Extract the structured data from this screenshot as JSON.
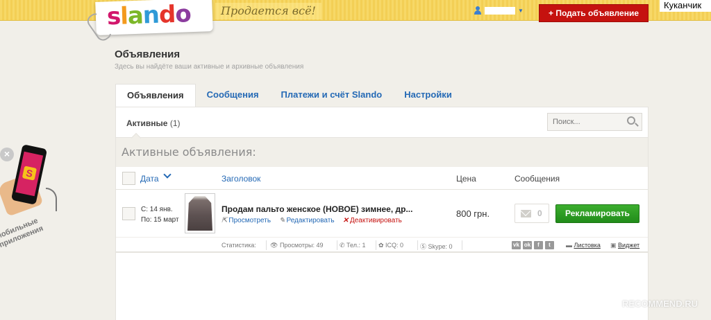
{
  "header": {
    "logo_text": "slando",
    "slogan": "Продается всё!",
    "post_button": "+ Подать объявление",
    "corner_name": "Куканчик"
  },
  "page": {
    "title": "Объявления",
    "subtitle": "Здесь вы найдёте ваши активные и архивные объявления"
  },
  "tabs": [
    {
      "label": "Объявления",
      "active": true
    },
    {
      "label": "Сообщения",
      "active": false
    },
    {
      "label": "Платежи и счёт Slando",
      "active": false
    },
    {
      "label": "Настройки",
      "active": false
    }
  ],
  "subbar": {
    "active_label": "Активные",
    "active_count": "(1)",
    "search_placeholder": "Поиск..."
  },
  "section_title": "Активные объявления:",
  "table": {
    "headers": {
      "date": "Дата",
      "title": "Заголовок",
      "price": "Цена",
      "messages": "Сообщения"
    }
  },
  "ad": {
    "date_from": "С: 14 янв.",
    "date_to": "По: 15 март",
    "title": "Продам пальто женское (НОВОЕ) зимнее, др...",
    "link_view": "Просмотреть",
    "link_edit": "Редактировать",
    "link_deactivate": "Деактивировать",
    "price": "800 грн.",
    "messages_count": "0",
    "promote_button": "Рекламировать"
  },
  "stats": {
    "label": "Статистика:",
    "views": "Просмотры: 49",
    "phone": "Тел.: 1",
    "icq": "ICQ: 0",
    "skype": "Skype: 0",
    "leaflet": "Листовка",
    "widget": "Виджет",
    "social": [
      "vk",
      "ok",
      "f",
      "t"
    ]
  },
  "promo": {
    "text": "мобильные приложения",
    "close": "×"
  },
  "watermark": "RECOMMEND.RU",
  "colors": {
    "accent_red": "#c5120f",
    "link_blue": "#2469b5",
    "promote_green": "#2f9e26",
    "topbar_yellow": "#f5d560"
  }
}
